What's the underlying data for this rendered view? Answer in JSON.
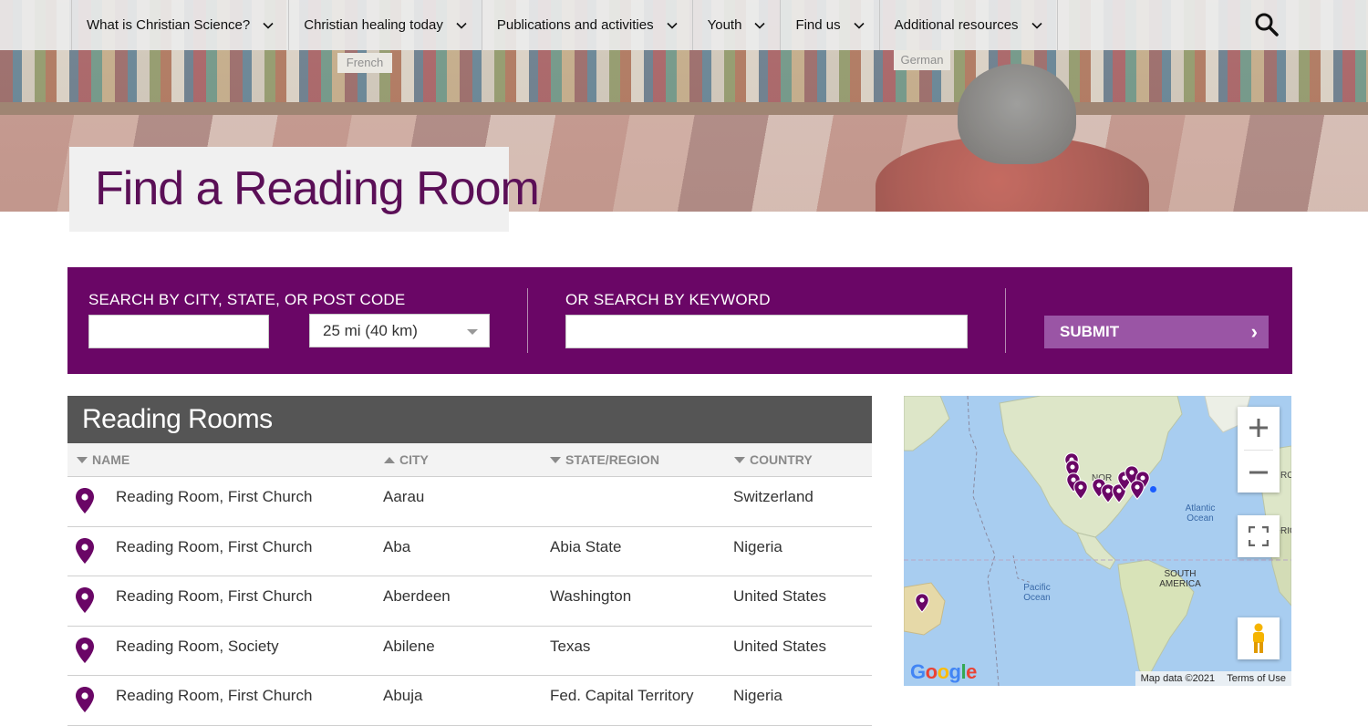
{
  "nav": {
    "items": [
      {
        "label": "What is Christian Science?"
      },
      {
        "label": "Christian healing today"
      },
      {
        "label": "Publications and activities"
      },
      {
        "label": "Youth"
      },
      {
        "label": "Find us"
      },
      {
        "label": "Additional resources"
      }
    ]
  },
  "hero": {
    "title": "Find a Reading Room",
    "shelf_labels": [
      "French",
      "German"
    ]
  },
  "search": {
    "location_label": "SEARCH BY CITY, STATE, OR POST CODE",
    "location_value": "",
    "distance_selected": "25 mi (40 km)",
    "keyword_label": "OR SEARCH BY KEYWORD",
    "keyword_value": "",
    "submit_label": "SUBMIT"
  },
  "rooms": {
    "heading": "Reading Rooms",
    "columns": [
      "NAME",
      "CITY",
      "STATE/REGION",
      "COUNTRY"
    ],
    "rows": [
      {
        "name": "Reading Room, First Church",
        "city": "Aarau",
        "state": "",
        "country": "Switzerland"
      },
      {
        "name": "Reading Room, First Church",
        "city": "Aba",
        "state": "Abia State",
        "country": "Nigeria"
      },
      {
        "name": "Reading Room, First Church",
        "city": "Aberdeen",
        "state": "Washington",
        "country": "United States"
      },
      {
        "name": "Reading Room, Society",
        "city": "Abilene",
        "state": "Texas",
        "country": "United States"
      },
      {
        "name": "Reading Room, First Church",
        "city": "Abuja",
        "state": "Fed. Capital Territory",
        "country": "Nigeria"
      }
    ]
  },
  "map": {
    "labels": [
      "NOR",
      "Atlantic Ocean",
      "SOUTH AMERICA",
      "Pacific Ocean",
      "RO",
      "RIC"
    ],
    "attribution": "Map data ©2021",
    "terms": "Terms of Use",
    "logo": "Google"
  },
  "colors": {
    "brand_purple": "#6a0666",
    "submit_purple": "#9a55a5",
    "table_header": "#555555"
  }
}
